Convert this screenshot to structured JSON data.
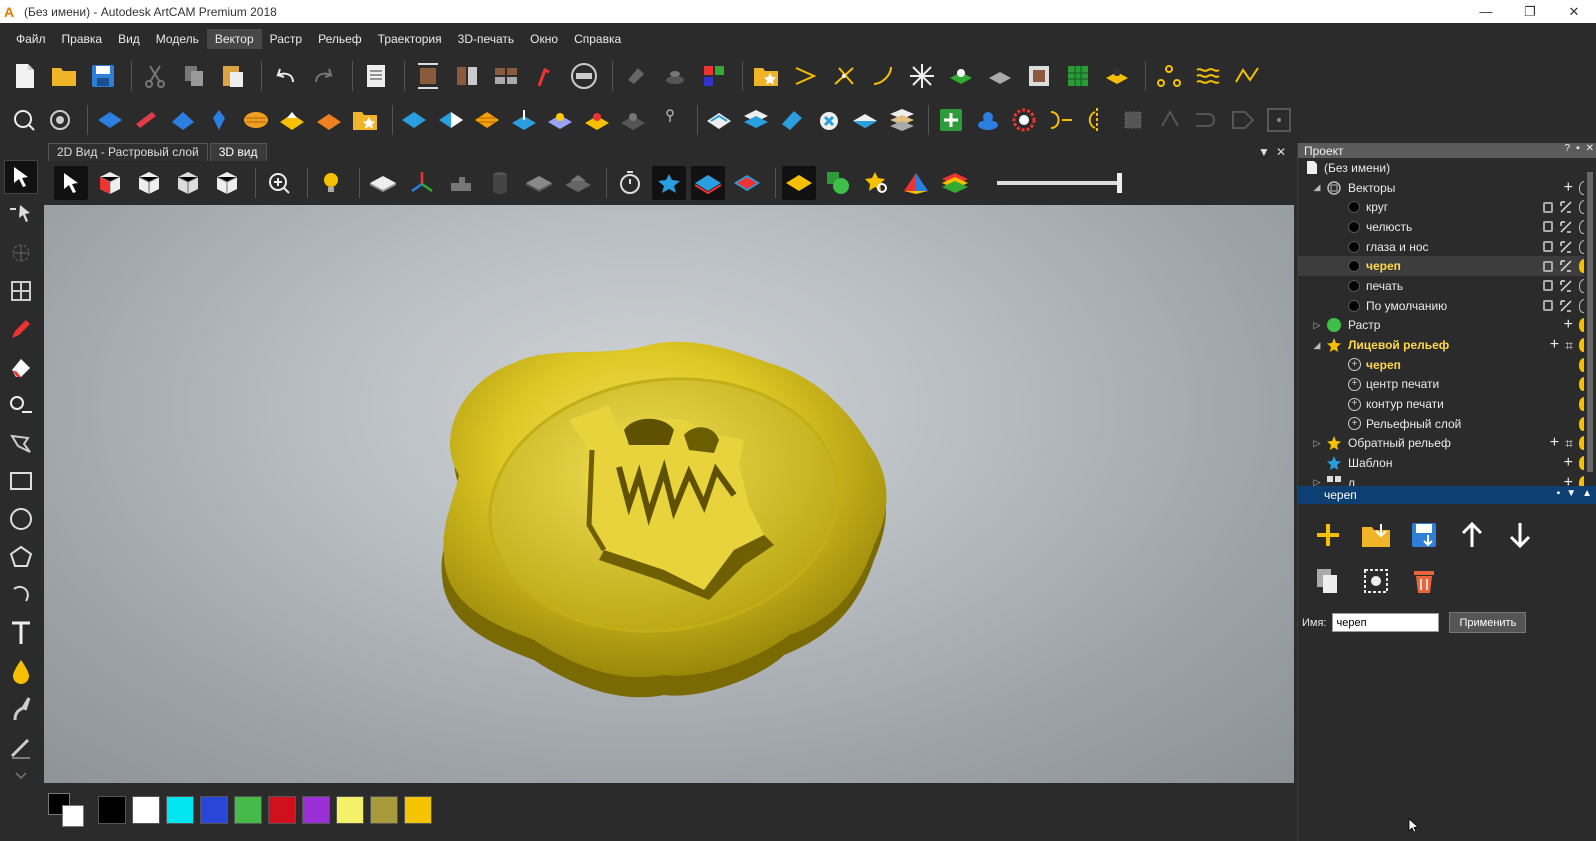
{
  "window": {
    "title": "(Без имени) - Autodesk ArtCAM Premium 2018",
    "app_icon": "A",
    "minimize": "—",
    "restore": "❐",
    "close": "✕"
  },
  "menu": {
    "items": [
      "Файл",
      "Правка",
      "Вид",
      "Модель",
      "Вектор",
      "Растр",
      "Рельеф",
      "Траектория",
      "3D-печать",
      "Окно",
      "Справка"
    ],
    "active_index": 4
  },
  "tabs": {
    "items": [
      "2D Вид - Растровый слой",
      "3D вид"
    ],
    "active_index": 1,
    "dropdown": "▼",
    "close": "✕"
  },
  "palette": {
    "colors": [
      "#000000",
      "#ffffff",
      "#00e5f0",
      "#2a46d8",
      "#47b84a",
      "#d0101c",
      "#9b2fd6",
      "#f5f06a",
      "#a69a3a",
      "#f5c400"
    ]
  },
  "panel": {
    "title": "Проект",
    "help": "?",
    "pin": "▪",
    "close": "✕",
    "tree": [
      {
        "label": "(Без имени)",
        "level": 0,
        "icon": "document-icon"
      },
      {
        "label": "Векторы",
        "level": 1,
        "icon": "vectors-icon",
        "expanded": true
      },
      {
        "label": "круг",
        "level": 2,
        "icon": "layer-dot-icon"
      },
      {
        "label": "челюсть",
        "level": 2,
        "icon": "layer-dot-icon"
      },
      {
        "label": "глаза и нос",
        "level": 2,
        "icon": "layer-dot-icon"
      },
      {
        "label": "череп",
        "level": 2,
        "icon": "layer-dot-icon",
        "active": true
      },
      {
        "label": "печать",
        "level": 2,
        "icon": "layer-dot-icon"
      },
      {
        "label": "По умолчанию",
        "level": 2,
        "icon": "layer-dot-icon"
      },
      {
        "label": "Растр",
        "level": 1,
        "icon": "raster-icon",
        "expanded": false
      },
      {
        "label": "Лицевой рельеф",
        "level": 1,
        "icon": "star-icon",
        "expanded": true,
        "active": true
      },
      {
        "label": "череп",
        "level": 2,
        "icon": "relief-layer-icon",
        "active": true
      },
      {
        "label": "центр печати",
        "level": 2,
        "icon": "relief-layer-icon"
      },
      {
        "label": "контур печати",
        "level": 2,
        "icon": "relief-layer-icon"
      },
      {
        "label": "Рельефный слой",
        "level": 2,
        "icon": "relief-layer-icon"
      },
      {
        "label": "Обратный рельеф",
        "level": 1,
        "icon": "star-icon",
        "expanded": false
      },
      {
        "label": "Шаблон",
        "level": 1,
        "icon": "template-star-icon"
      },
      {
        "label": "л",
        "level": 1,
        "icon": "grid-icon",
        "expanded": false
      }
    ]
  },
  "layer_panel": {
    "title": "череп",
    "name_label": "Имя:",
    "name_value": "череп",
    "apply_label": "Применить"
  }
}
